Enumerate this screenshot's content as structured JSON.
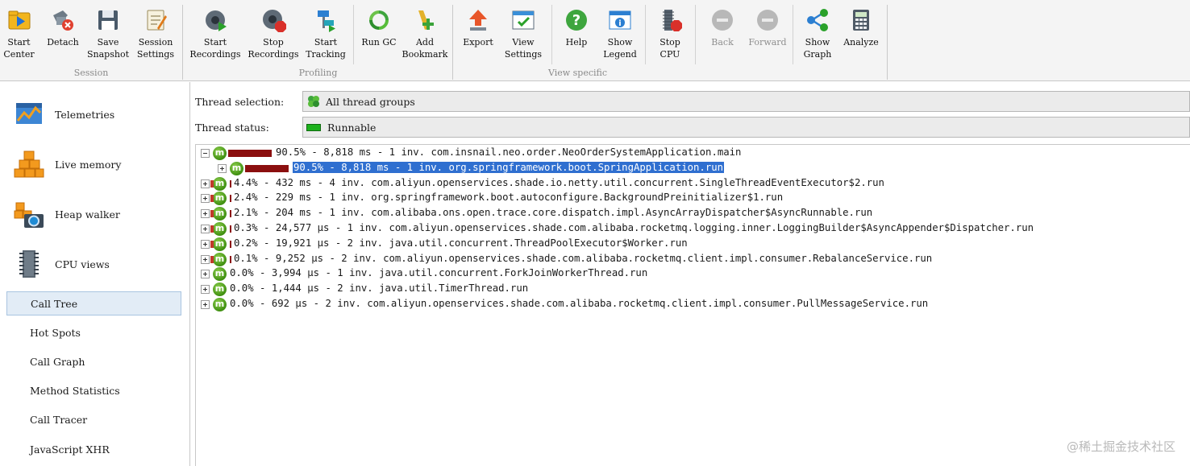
{
  "toolbar": {
    "groups": [
      {
        "label": "Session"
      },
      {
        "label": "Profiling"
      },
      {
        "label": "View specific"
      }
    ],
    "buttons": [
      {
        "label": "Start\nCenter"
      },
      {
        "label": "Detach"
      },
      {
        "label": "Save\nSnapshot"
      },
      {
        "label": "Session\nSettings"
      },
      {
        "label": "Start\nRecordings"
      },
      {
        "label": "Stop\nRecordings"
      },
      {
        "label": "Start\nTracking"
      },
      {
        "label": "Run GC"
      },
      {
        "label": "Add\nBookmark"
      },
      {
        "label": "Export"
      },
      {
        "label": "View\nSettings"
      },
      {
        "label": "Help"
      },
      {
        "label": "Show\nLegend"
      },
      {
        "label": "Stop\nCPU"
      },
      {
        "label": "Back"
      },
      {
        "label": "Forward"
      },
      {
        "label": "Show\nGraph"
      },
      {
        "label": "Analyze"
      }
    ]
  },
  "sidebar": {
    "sections": [
      {
        "label": "Telemetries",
        "icon": "telemetries-icon"
      },
      {
        "label": "Live memory",
        "icon": "live-memory-icon"
      },
      {
        "label": "Heap walker",
        "icon": "heap-walker-icon"
      },
      {
        "label": "CPU views",
        "icon": "cpu-views-icon"
      }
    ],
    "items": [
      {
        "label": "Call Tree",
        "selected": true
      },
      {
        "label": "Hot Spots"
      },
      {
        "label": "Call Graph"
      },
      {
        "label": "Method Statistics"
      },
      {
        "label": "Call Tracer"
      },
      {
        "label": "JavaScript XHR"
      }
    ]
  },
  "main": {
    "thread_selection": {
      "label": "Thread selection:",
      "value": "All thread groups"
    },
    "thread_status": {
      "label": "Thread status:",
      "value": "Runnable",
      "color": "#1db11d"
    },
    "tree": [
      {
        "text": "90.5% - 8,818 ms - 1 inv. com.insnail.neo.order.NeoOrderSystemApplication.main",
        "depth": 0,
        "expanded": true,
        "percent": 90.5
      },
      {
        "text": "90.5% - 8,818 ms - 1 inv. org.springframework.boot.SpringApplication.run",
        "depth": 1,
        "expanded": false,
        "percent": 90.5,
        "selected": true
      },
      {
        "text": "4.4% - 432 ms - 4 inv. com.aliyun.openservices.shade.io.netty.util.concurrent.SingleThreadEventExecutor$2.run",
        "depth": 0,
        "expanded": false,
        "percent": 4.4
      },
      {
        "text": "2.4% - 229 ms - 1 inv. org.springframework.boot.autoconfigure.BackgroundPreinitializer$1.run",
        "depth": 0,
        "expanded": false,
        "percent": 2.4
      },
      {
        "text": "2.1% - 204 ms - 1 inv. com.alibaba.ons.open.trace.core.dispatch.impl.AsyncArrayDispatcher$AsyncRunnable.run",
        "depth": 0,
        "expanded": false,
        "percent": 2.1
      },
      {
        "text": "0.3% - 24,577 µs - 1 inv. com.aliyun.openservices.shade.com.alibaba.rocketmq.logging.inner.LoggingBuilder$AsyncAppender$Dispatcher.run",
        "depth": 0,
        "expanded": false,
        "percent": 0.3
      },
      {
        "text": "0.2% - 19,921 µs - 2 inv. java.util.concurrent.ThreadPoolExecutor$Worker.run",
        "depth": 0,
        "expanded": false,
        "percent": 0.2
      },
      {
        "text": "0.1% - 9,252 µs - 2 inv. com.aliyun.openservices.shade.com.alibaba.rocketmq.client.impl.consumer.RebalanceService.run",
        "depth": 0,
        "expanded": false,
        "percent": 0.1
      },
      {
        "text": "0.0% - 3,994 µs - 1 inv. java.util.concurrent.ForkJoinWorkerThread.run",
        "depth": 0,
        "expanded": false,
        "percent": 0.0
      },
      {
        "text": "0.0% - 1,444 µs - 2 inv. java.util.TimerThread.run",
        "depth": 0,
        "expanded": false,
        "percent": 0.0
      },
      {
        "text": "0.0% - 692 µs - 2 inv. com.aliyun.openservices.shade.com.alibaba.rocketmq.client.impl.consumer.PullMessageService.run",
        "depth": 0,
        "expanded": false,
        "percent": 0.0
      }
    ]
  },
  "watermark": "@稀土掘金技术社区"
}
